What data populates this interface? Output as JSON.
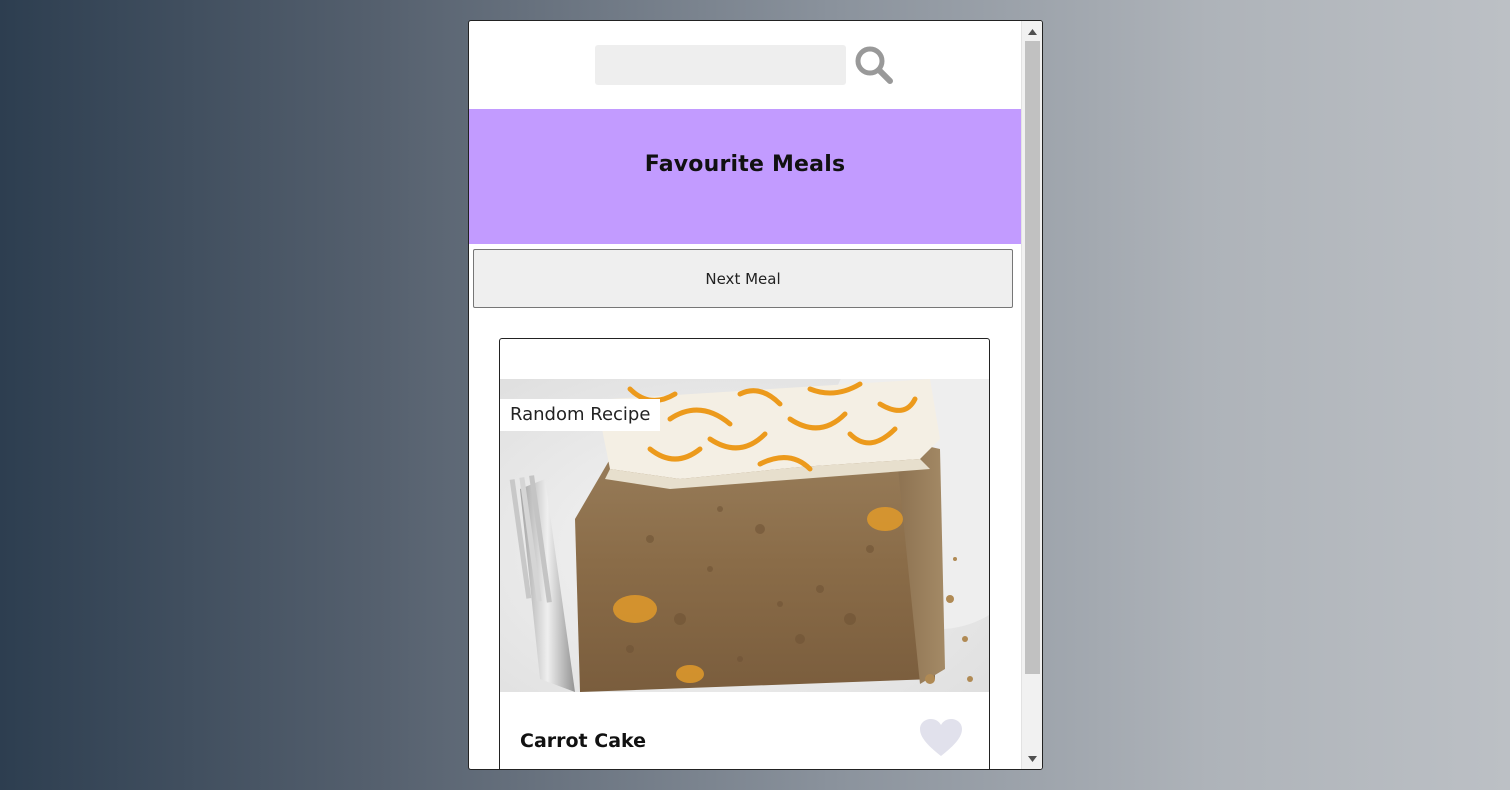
{
  "search": {
    "value": "",
    "placeholder": "",
    "button_icon": "search-icon"
  },
  "favourites": {
    "title": "Favourite Meals"
  },
  "controls": {
    "next_meal_label": "Next Meal"
  },
  "meal": {
    "badge": "Random Recipe",
    "name": "Carrot Cake",
    "image_alt": "carrot cake slice with cream cheese frosting and orange zest",
    "favourite_icon": "heart-icon",
    "favourited": false
  },
  "colors": {
    "accent": "#c29bff",
    "heart_inactive": "#e1e1ec",
    "search_icon": "#999999"
  }
}
